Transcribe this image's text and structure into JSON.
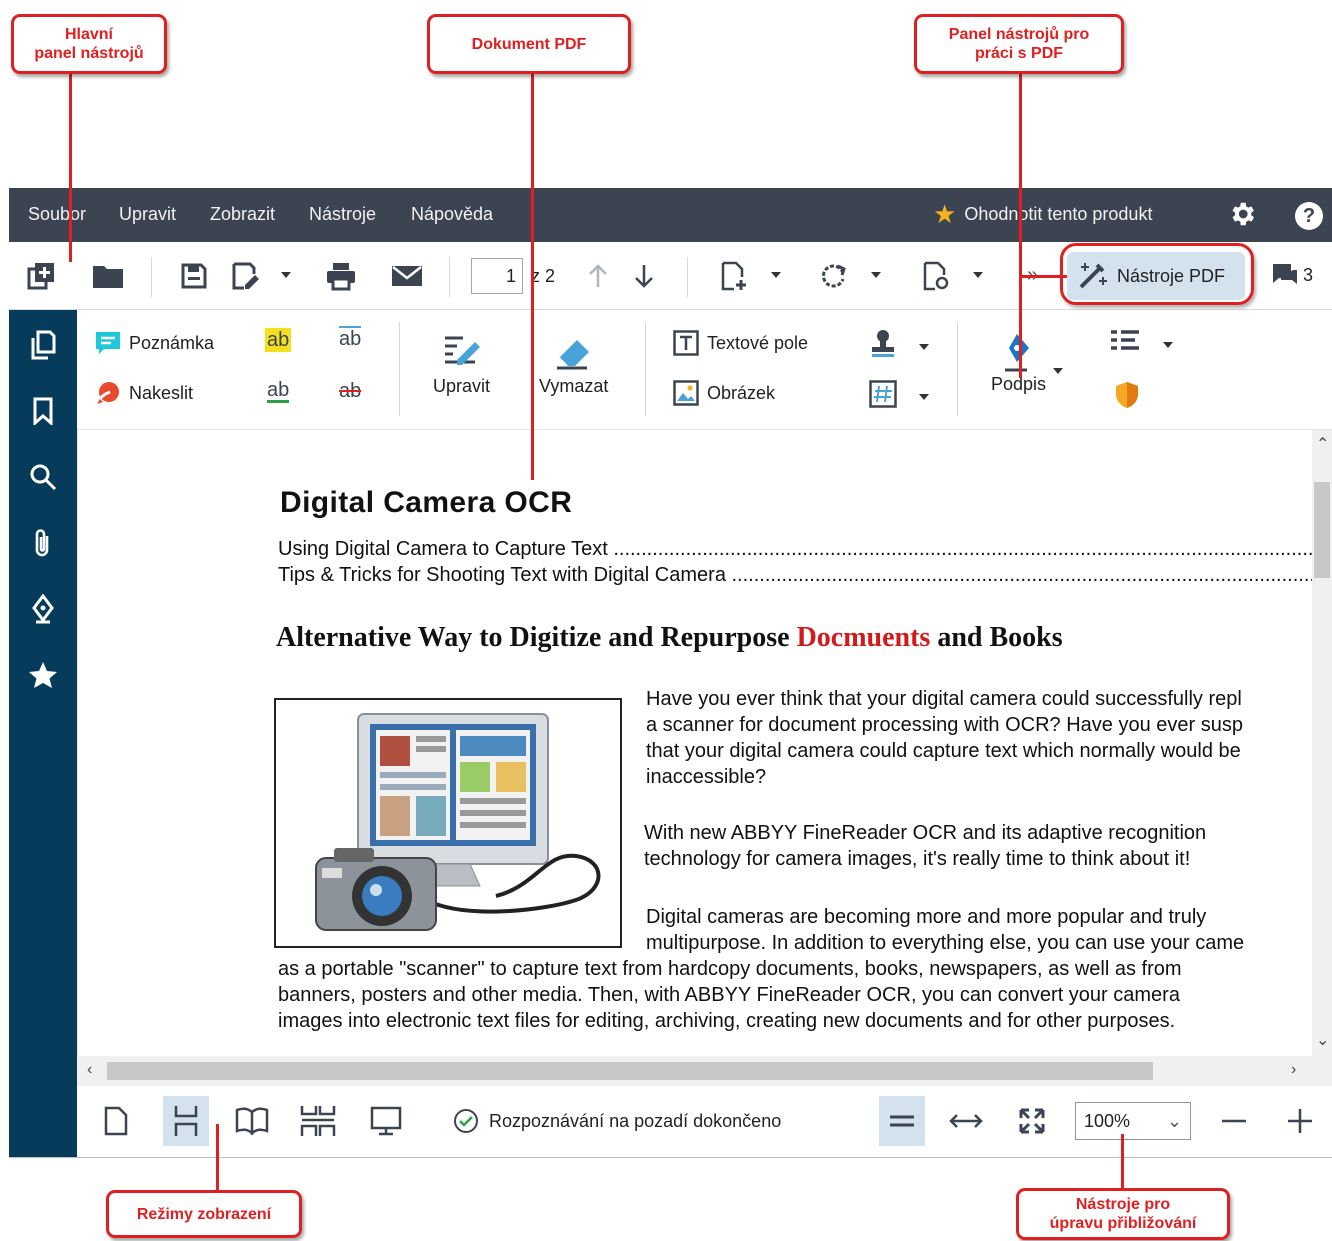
{
  "callouts": {
    "main_toolbar": "Hlavní\npanel nástrojů",
    "pdf_document": "Dokument PDF",
    "pdf_toolbar": "Panel nástrojů pro\npráci s PDF",
    "view_modes": "Režimy zobrazení",
    "zoom_tools": "Nástroje pro\núpravu přibližování"
  },
  "menu": {
    "items": [
      "Soubor",
      "Upravit",
      "Zobrazit",
      "Nástroje",
      "Nápověda"
    ],
    "rate_label": "Ohodnotit tento produkt"
  },
  "toolbar": {
    "page_current": "1",
    "page_of": "z 2",
    "pdf_tools_label": "Nástroje PDF",
    "comments_count": "3"
  },
  "pdf_tools": {
    "note": "Poznámka",
    "draw": "Nakeslit",
    "highlight_glyph": "ab",
    "edit": "Upravit",
    "erase": "Vymazat",
    "text_field": "Textové pole",
    "image": "Obrázek",
    "signature": "Podpis"
  },
  "document": {
    "title": "Digital  Camera  OCR",
    "toc": [
      "Using  Digital  Camera  to  Capture  Text  ..................................................................................................................................................",
      "Tips  &  Tricks  for  Shooting  Text  with  Digital  Camera  ......................................................................................................................"
    ],
    "heading_before": "Alternative Way to Digitize and Repurpose ",
    "heading_red": "Docmuents",
    "heading_after": " and Books",
    "para1": "Have you ever think that your digital camera could successfully repl\na scanner for document processing with OCR? Have you ever susp\nthat your digital camera could capture text which  normally would be\ninaccessible?",
    "para2": "With new ABBYY FineReader OCR and its adaptive recognition\ntechnology   for camera images, it's really time to think about it!",
    "para3": "Digital cameras are becoming more and more popular and truly\nmultipurpose.  In addition to everything else, you can use your came",
    "para4": "as a portable \"scanner\" to capture text from hardcopy documents, books, newspapers, as well as from\nbanners, posters and other media. Then, with ABBYY FineReader OCR, you can convert your camera\nimages into electronic text files for editing, archiving, creating new documents and for other purposes."
  },
  "status": {
    "text": "Rozpoznávání na pozadí dokončeno",
    "zoom": "100%"
  },
  "colors": {
    "accent_red": "#e02020",
    "menubar_bg": "#3b4450",
    "sidebar_bg": "#073b5c",
    "active_bg": "#d4e2ee"
  }
}
